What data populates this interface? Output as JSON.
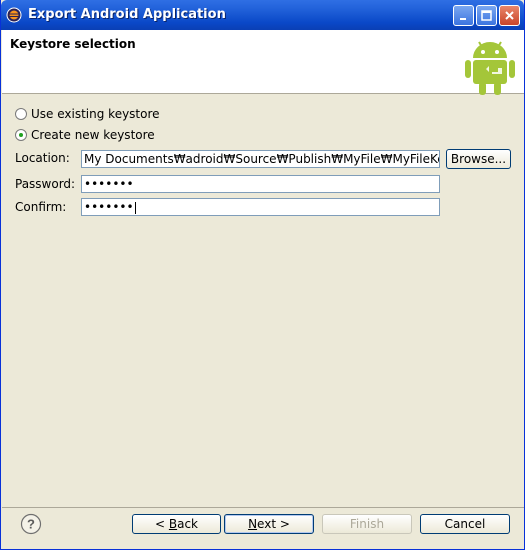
{
  "window": {
    "title": "Export Android Application"
  },
  "header": {
    "title": "Keystore selection",
    "logo_icon": "android-robot-icon",
    "accent_color": "#a4c639"
  },
  "options": {
    "use_existing": "Use existing keystore",
    "create_new": "Create new keystore",
    "selected": "create_new"
  },
  "form": {
    "location_label": "Location:",
    "location_value": "My Documents₩adroid₩Source₩Publish₩MyFile₩MyFileKey",
    "browse_label": "Browse...",
    "password_label": "Password:",
    "password_value": "•••••••",
    "confirm_label": "Confirm:",
    "confirm_value": "•••••••"
  },
  "footer": {
    "help_icon": "help-icon",
    "back_arrow": "<",
    "back_mnemonic": "B",
    "back_rest": "ack",
    "next_mnemonic": "N",
    "next_rest": "ext",
    "next_arrow": ">",
    "finish_label": "Finish",
    "cancel_label": "Cancel"
  }
}
